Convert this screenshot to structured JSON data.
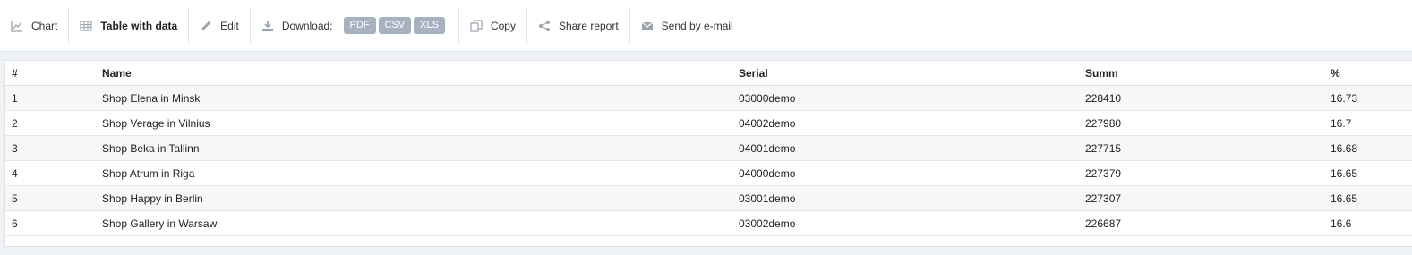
{
  "toolbar": {
    "chart": "Chart",
    "table": "Table with data",
    "edit": "Edit",
    "download": "Download:",
    "formats": [
      "PDF",
      "CSV",
      "XLS"
    ],
    "copy": "Copy",
    "share": "Share report",
    "email": "Send by e-mail"
  },
  "table": {
    "headers": [
      "#",
      "Name",
      "Serial",
      "Summ",
      "%"
    ],
    "rows": [
      [
        "1",
        "Shop Elena in Minsk",
        "03000demo",
        "228410",
        "16.73"
      ],
      [
        "2",
        "Shop Verage in Vilnius",
        "04002demo",
        "227980",
        "16.7"
      ],
      [
        "3",
        "Shop Beka in Tallinn",
        "04001demo",
        "227715",
        "16.68"
      ],
      [
        "4",
        "Shop Atrum in Riga",
        "04000demo",
        "227379",
        "16.65"
      ],
      [
        "5",
        "Shop Happy in Berlin",
        "03001demo",
        "227307",
        "16.65"
      ],
      [
        "6",
        "Shop Gallery in Warsaw",
        "03002demo",
        "226687",
        "16.6"
      ]
    ]
  },
  "colors": {
    "icon": "#9aa3ad",
    "format_button": "#a7b2c1"
  }
}
